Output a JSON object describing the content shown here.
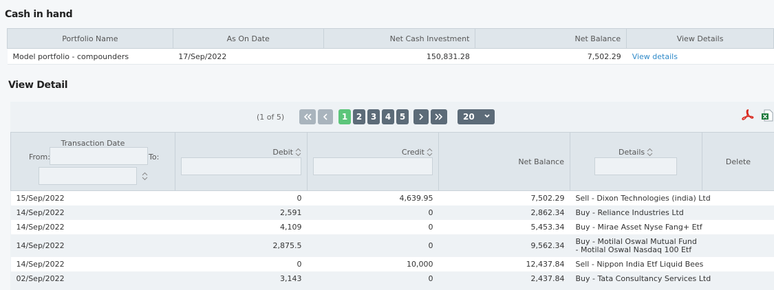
{
  "cash": {
    "title": "Cash in hand",
    "headers": [
      "Portfolio Name",
      "As On Date",
      "Net Cash Investment",
      "Net Balance",
      "View Details"
    ],
    "row": {
      "name": "Model portfolio - compounders",
      "date": "17/Sep/2022",
      "investment": "150,831.28",
      "balance": "7,502.29",
      "link": "View details"
    }
  },
  "detail": {
    "title": "View Detail",
    "page_info": "(1 of 5)",
    "pages": [
      "1",
      "2",
      "3",
      "4",
      "5"
    ],
    "active_page": "1",
    "page_size": "20",
    "headers": {
      "date": "Transaction Date",
      "from": "From:",
      "to": "To:",
      "debit": "Debit",
      "credit": "Credit",
      "balance": "Net Balance",
      "details": "Details",
      "delete": "Delete"
    },
    "rows": [
      {
        "date": "15/Sep/2022",
        "debit": "0",
        "credit": "4,639.95",
        "balance": "7,502.29",
        "details": "Sell - Dixon Technologies (india) Ltd"
      },
      {
        "date": "14/Sep/2022",
        "debit": "2,591",
        "credit": "0",
        "balance": "2,862.34",
        "details": "Buy - Reliance Industries Ltd"
      },
      {
        "date": "14/Sep/2022",
        "debit": "4,109",
        "credit": "0",
        "balance": "5,453.34",
        "details": "Buy - Mirae Asset Nyse Fang+ Etf"
      },
      {
        "date": "14/Sep/2022",
        "debit": "2,875.5",
        "credit": "0",
        "balance": "9,562.34",
        "details": "Buy - Motilal Oswal Mutual Fund - Motilal Oswal Nasdaq 100 Etf"
      },
      {
        "date": "14/Sep/2022",
        "debit": "0",
        "credit": "10,000",
        "balance": "12,437.84",
        "details": "Sell - Nippon India Etf Liquid Bees"
      },
      {
        "date": "02/Sep/2022",
        "debit": "3,143",
        "credit": "0",
        "balance": "2,437.84",
        "details": "Buy - Tata Consultancy Services Ltd"
      }
    ]
  },
  "icons": {
    "pdf": "pdf-export-icon",
    "excel": "excel-export-icon",
    "colors": {
      "pdf": "#d9261c",
      "excel": "#1e7a3c",
      "active_page": "#5cc57a",
      "pager": "#5c6b78",
      "link": "#2f8ac9"
    }
  }
}
